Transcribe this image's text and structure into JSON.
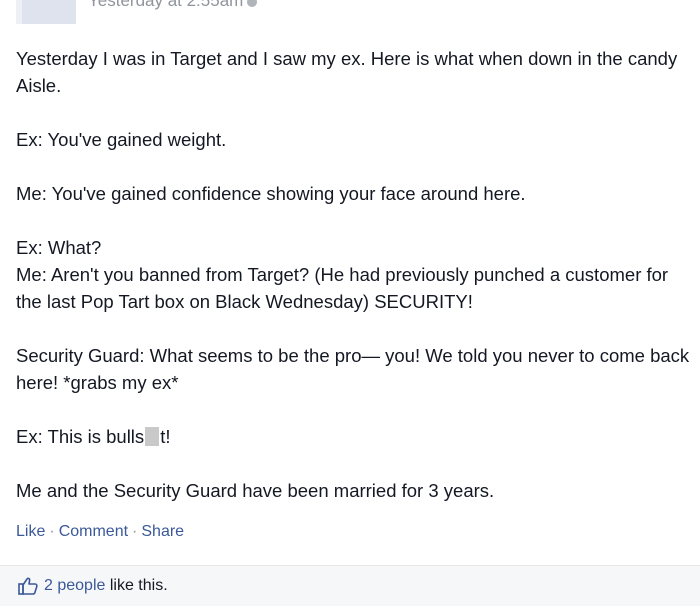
{
  "post": {
    "timestamp": "Yesterday at 2:55am",
    "lines": [
      "Yesterday I was in Target and I saw my ex. Here is what when down in the candy Aisle.",
      "Ex: You've gained weight.",
      "Me: You've gained confidence showing your face around here.",
      "Ex: What?",
      "Me: Aren't you banned from Target? (He had previously punched a customer for the last Pop Tart box on Black Wednesday) SECURITY!",
      "Security Guard: What seems to be the pro— you! We told you never to come back here! *grabs my ex*",
      "Ex: This is bulls",
      "t!",
      "Me and the Security Guard have been married for 3 years."
    ]
  },
  "actions": {
    "like": "Like",
    "comment": "Comment",
    "share": "Share",
    "separator": "·"
  },
  "likes": {
    "people_link": "2 people",
    "suffix": " like this."
  },
  "colors": {
    "link": "#3b5998",
    "text": "#141823",
    "muted": "#90949c",
    "likes_bar_bg": "#f6f7f9"
  },
  "icons": {
    "like": "thumbs-up-icon",
    "privacy": "globe-icon"
  }
}
